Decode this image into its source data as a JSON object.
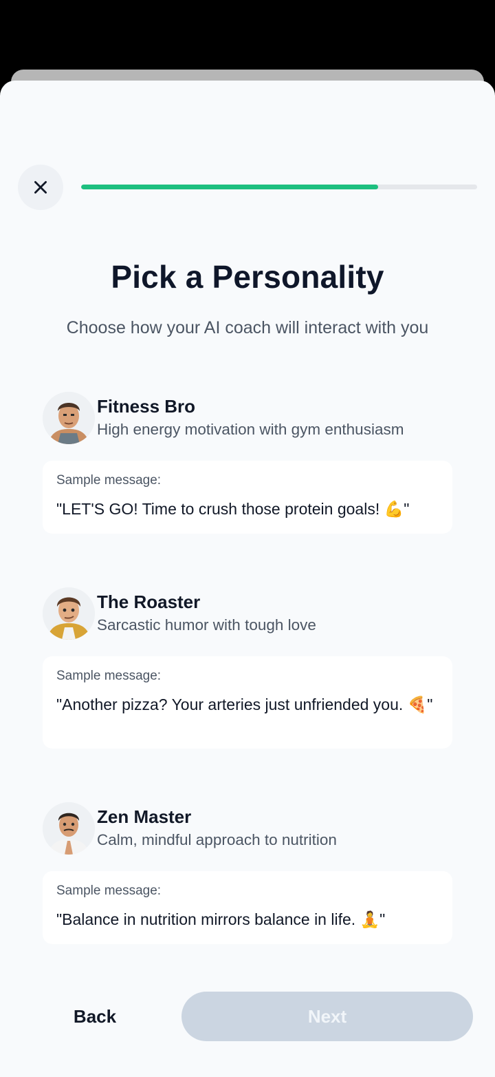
{
  "progress": {
    "fraction": 0.75
  },
  "header": {
    "title": "Pick a Personality",
    "subtitle": "Choose how your AI coach will interact with you"
  },
  "personas": [
    {
      "name": "Fitness Bro",
      "description": "High energy motivation with gym enthusiasm",
      "sample_label": "Sample message:",
      "sample_text": "\"LET'S GO! Time to crush those protein goals! 💪\""
    },
    {
      "name": "The Roaster",
      "description": "Sarcastic humor with tough love",
      "sample_label": "Sample message:",
      "sample_text": "\"Another pizza? Your arteries just unfriended you. 🍕\""
    },
    {
      "name": "Zen Master",
      "description": "Calm, mindful approach to nutrition",
      "sample_label": "Sample message:",
      "sample_text": "\"Balance in nutrition mirrors balance in life. 🧘\""
    }
  ],
  "footer": {
    "back_label": "Back",
    "next_label": "Next"
  },
  "colors": {
    "accent": "#1dbf7f",
    "next_disabled": "#cbd5e1",
    "background": "#f8fafc"
  }
}
